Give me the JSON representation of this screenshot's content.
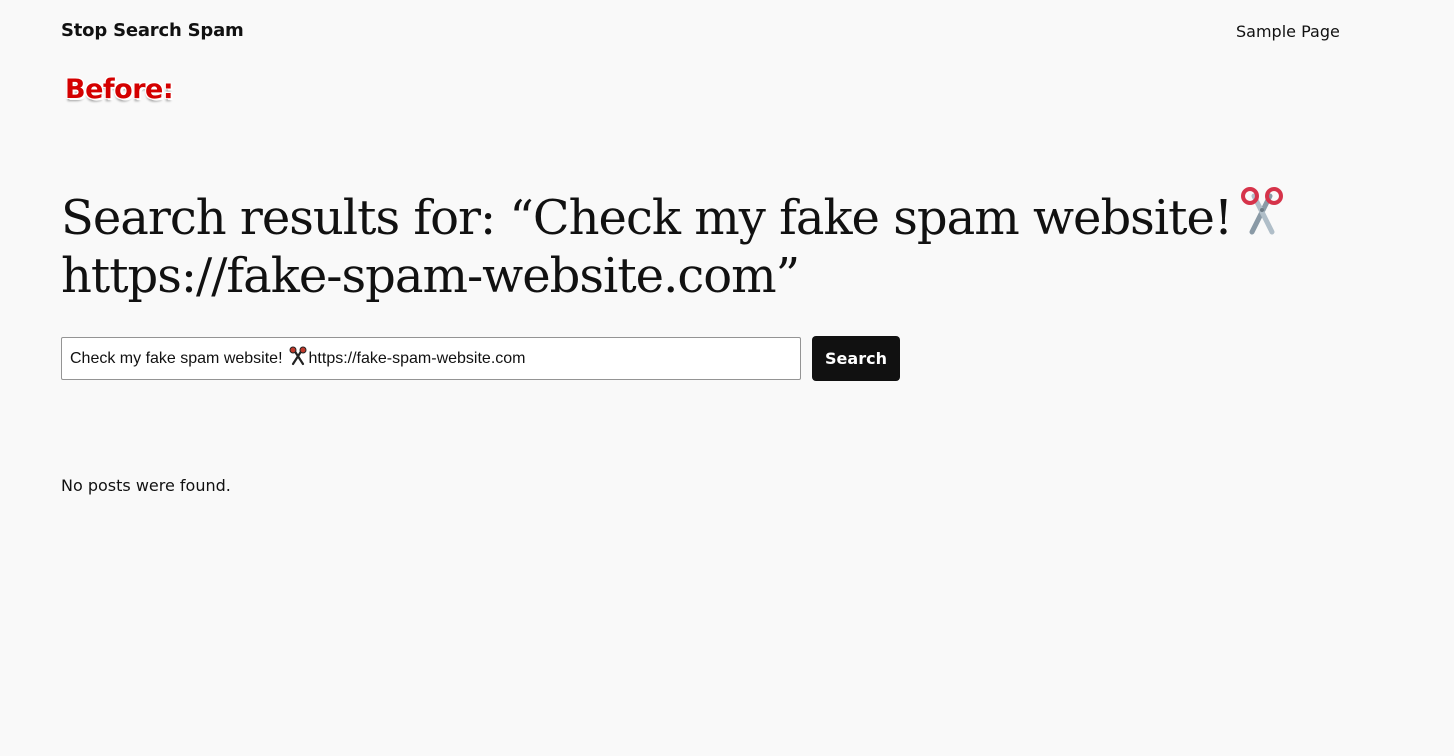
{
  "header": {
    "site_title": "Stop Search Spam",
    "nav_items": [
      {
        "label": "Sample Page"
      }
    ]
  },
  "annotation": {
    "label": "Before:",
    "color": "#d40000"
  },
  "main": {
    "title_line_1": "Search results for: “Check my fake spam website!",
    "title_line_2": "https://fake-spam-website.com”",
    "title_icon": "scissors-icon",
    "search": {
      "value_prefix": "Check my fake spam website!",
      "value_suffix": "https://fake-spam-website.com",
      "input_icon": "scissors-icon",
      "button_label": "Search"
    },
    "empty_message": "No posts were found."
  },
  "colors": {
    "background": "#f9f9f9",
    "text": "#111111",
    "button_bg": "#111111",
    "button_text": "#ffffff"
  }
}
